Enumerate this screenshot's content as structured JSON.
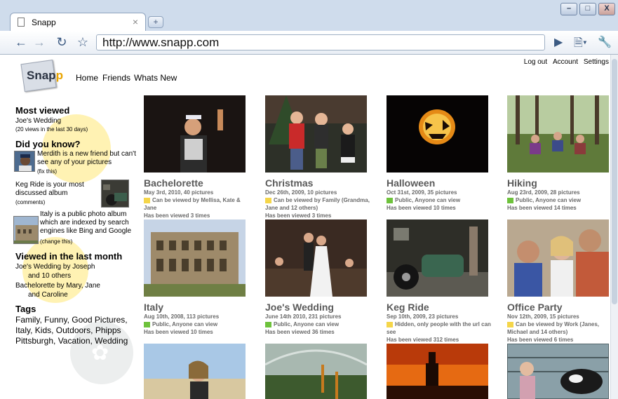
{
  "browser": {
    "tab_title": "Snapp",
    "tab_close": "×",
    "new_tab": "+",
    "url": "http://www.snapp.com",
    "window_controls": [
      "–",
      "□",
      "X"
    ]
  },
  "site": {
    "logo": "Snapp",
    "nav": [
      "Home",
      "Friends",
      "Whats New"
    ],
    "top_links": [
      "Log out",
      "Account",
      "Settings"
    ]
  },
  "sidebar": {
    "most_viewed": {
      "heading": "Most viewed",
      "album": "Joe's Wedding",
      "views": "(20 views in the last 30 days)"
    },
    "did_you_know": {
      "heading": "Did you know?",
      "tip1": "Merdith is a new friend but can't see any of your pictures",
      "tip1_action": "(fix this)",
      "tip2": "Keg Ride is your most discussed album",
      "tip2_action": "(comments)",
      "tip3": "Italy is a public photo album which are indexed by search engines like Bing and Google",
      "tip3_action": "(change this)"
    },
    "viewed_last_month": {
      "heading": "Viewed in the last month",
      "line1": "Joe's Wedding by Joseph",
      "line1b": "and 10 others",
      "line2": "Bachelorette by Mary, Jane",
      "line2b": "and Caroline"
    },
    "tags": {
      "heading": "Tags",
      "text": "Family, Funny, Good Pictures, Italy, Kids, Outdoors, Phipps Pittsburgh, Vacation, Wedding"
    }
  },
  "albums": [
    {
      "title": "Bachelorette",
      "meta": "May 3rd, 2010,  40 pictures",
      "privacy": "Can be viewed by Mellisa, Kate & Jane",
      "privacy_color": "yellow",
      "views": "Has been viewed 3 times"
    },
    {
      "title": "Christmas",
      "meta": "Dec 26th, 2009, 10 pictures",
      "privacy": "Can be viewed by Family (Grandma, Jane and 12 others)",
      "privacy_color": "yellow",
      "views": "Has been viewed 3 times"
    },
    {
      "title": "Halloween",
      "meta": "Oct 31st, 2009, 35 pictures",
      "privacy": "Public, Anyone can view",
      "privacy_color": "green",
      "views": "Has been viewed 10 times"
    },
    {
      "title": "Hiking",
      "meta": "Aug 23rd, 2009, 28 pictures",
      "privacy": "Public, Anyone can view",
      "privacy_color": "green",
      "views": "Has been viewed 14 times"
    },
    {
      "title": "Italy",
      "meta": "Aug 10th, 2008, 113 pictures",
      "privacy": "Public, Anyone can view",
      "privacy_color": "green",
      "views": "Has been viewed 10 times"
    },
    {
      "title": "Joe's Wedding",
      "meta": "June 14th 2010,  231 pictures",
      "privacy": "Public, Anyone can view",
      "privacy_color": "green",
      "views": "Has been viewed 36 times"
    },
    {
      "title": "Keg Ride",
      "meta": "Sep 10th, 2009,  23 pictures",
      "privacy": "Hidden, only people with the url can see",
      "privacy_color": "yellow",
      "views": "Has been viewed 312 times"
    },
    {
      "title": "Office Party",
      "meta": "Nov 12th, 2009, 15 pictures",
      "privacy": "Can be viewed by Work (Janes, Michael and 14 others)",
      "privacy_color": "yellow",
      "views": "Has been viewed 6 times"
    }
  ]
}
